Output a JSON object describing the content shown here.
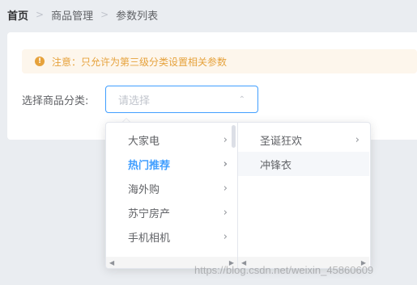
{
  "breadcrumb": {
    "home": "首页",
    "section": "商品管理",
    "current": "参数列表"
  },
  "alert": {
    "icon": "exclamation-icon",
    "text": "注意：只允许为第三级分类设置相关参数",
    "color": "#e6a23c"
  },
  "form": {
    "label": "选择商品分类:",
    "placeholder": "请选择",
    "accent": "#409eff"
  },
  "cascader": {
    "level1": [
      {
        "label": "大家电",
        "has_children": true
      },
      {
        "label": "热门推荐",
        "has_children": true,
        "active": true
      },
      {
        "label": "海外购",
        "has_children": true
      },
      {
        "label": "苏宁房产",
        "has_children": true
      },
      {
        "label": "手机相机",
        "has_children": true
      }
    ],
    "level2": [
      {
        "label": "圣诞狂欢",
        "has_children": true
      },
      {
        "label": "冲锋衣",
        "has_children": false,
        "hover": true
      }
    ]
  },
  "watermark": "https://blog.csdn.net/weixin_45860609"
}
